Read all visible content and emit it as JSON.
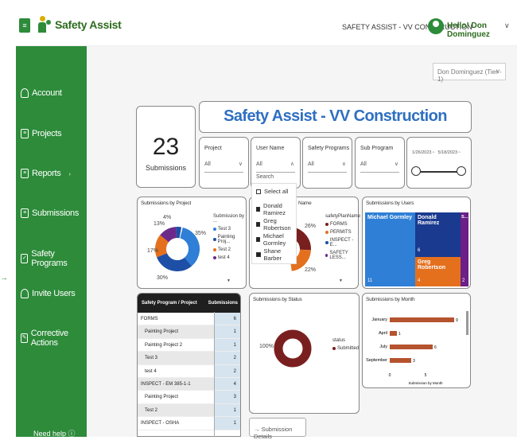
{
  "header": {
    "menu_icon_label": "≡",
    "logo_text": "Safety Assist",
    "company": "SAFETY ASSIST - VV CONSTRUCTION",
    "greeting": "Hello! Don Dominguez",
    "caret": "∨"
  },
  "sidebar": {
    "items": [
      {
        "label": "Account",
        "icon": "user-icon"
      },
      {
        "label": "Projects",
        "icon": "document-icon"
      },
      {
        "label": "Reports",
        "icon": "document-icon"
      },
      {
        "label": "Submissions",
        "icon": "clipboard-icon"
      },
      {
        "label": "Safety Programs",
        "icon": "check-icon"
      },
      {
        "label": "Invite Users",
        "icon": "add-user-icon"
      },
      {
        "label": "Corrective Actions",
        "icon": "edit-icon"
      }
    ],
    "need_help": "Need help ⓘ"
  },
  "tier_select": {
    "value": "Don Dominguez (Tier - 1)"
  },
  "dashboard": {
    "title": "Safety Assist - VV Construction",
    "kpi": {
      "value": "23",
      "label": "Submissions"
    },
    "filters": {
      "project": {
        "label": "Project",
        "value": "All"
      },
      "user_name": {
        "label": "User Name",
        "value": "All",
        "search": "Search"
      },
      "safety_programs": {
        "label": "Safety Programs",
        "value": "All"
      },
      "sub_program": {
        "label": "Sub Program",
        "value": "All"
      },
      "date_start": "1/26/2023",
      "date_end": "5/18/2023"
    },
    "user_dropdown": {
      "options": [
        "Select all",
        "Donald Ramirez",
        "Greg Robertson",
        "Michael Gormley",
        "Shane Barber"
      ]
    },
    "submissions_by_project": {
      "title": "Submissions by Project",
      "legend_title": "Submission by ...",
      "legend": [
        "Test 3",
        "Painting Proj...",
        "Test 2",
        "test 4"
      ],
      "labels": [
        "4%",
        "13%",
        "35%",
        "17%",
        "30%"
      ],
      "colors": [
        "#2f7fd6",
        "#1d4fa7",
        "#e4701e",
        "#6b2a8a"
      ]
    },
    "submissions_by_plan": {
      "title_suffix": "Name",
      "legend_title": "safetyPlanName",
      "legend": [
        "FORMS",
        "PERMITS",
        "INSPECT - E...",
        "SAFETY LESS..."
      ],
      "labels": [
        "26%",
        "22%"
      ],
      "colors": [
        "#7a1f1f",
        "#e4701e",
        "#1d4fa7",
        "#6b2a8a"
      ]
    },
    "submissions_by_users": {
      "title": "Submissions by Users",
      "tiles": [
        {
          "name": "Michael Gormley",
          "count": "11",
          "color": "#2f7fd6"
        },
        {
          "name": "Donald Ramirez",
          "count": "6",
          "color": "#1a3a8f"
        },
        {
          "name": "S...",
          "count": "2",
          "color": "#6b1f87"
        },
        {
          "name": "Greg Robertson",
          "count": "4",
          "color": "#e4701e"
        }
      ]
    },
    "table": {
      "headers": [
        "Safety Program / Project",
        "Submissions"
      ],
      "rows": [
        {
          "name": "FORMS",
          "value": "6",
          "indent": 0
        },
        {
          "name": "Painting Project",
          "value": "1",
          "indent": 1
        },
        {
          "name": "Painting Project 2",
          "value": "1",
          "indent": 1
        },
        {
          "name": "Test 3",
          "value": "2",
          "indent": 1
        },
        {
          "name": "test 4",
          "value": "2",
          "indent": 1
        },
        {
          "name": "INSPECT - EM 385-1-1",
          "value": "4",
          "indent": 0
        },
        {
          "name": "Painting Project",
          "value": "3",
          "indent": 1
        },
        {
          "name": "Test 2",
          "value": "1",
          "indent": 1
        },
        {
          "name": "INSPECT - OSHA",
          "value": "1",
          "indent": 0
        }
      ]
    },
    "submissions_by_status": {
      "title": "Submissions by Status",
      "label": "100%",
      "legend_title": "status",
      "legend_item": "Submitted",
      "color": "#7a1f1f"
    },
    "submissions_by_month": {
      "title": "Submissions by Month",
      "xlabel": "Submission by Month",
      "ticks": [
        "0",
        "5"
      ]
    },
    "submission_details_button": "Submission Details"
  },
  "chart_data": {
    "type": "bar",
    "title": "Submissions by Month",
    "xlabel": "Submission by Month",
    "categories": [
      "January",
      "April",
      "July",
      "September"
    ],
    "values": [
      9,
      1,
      6,
      3
    ],
    "xlim": [
      0,
      10
    ],
    "color": "#b5532e"
  }
}
